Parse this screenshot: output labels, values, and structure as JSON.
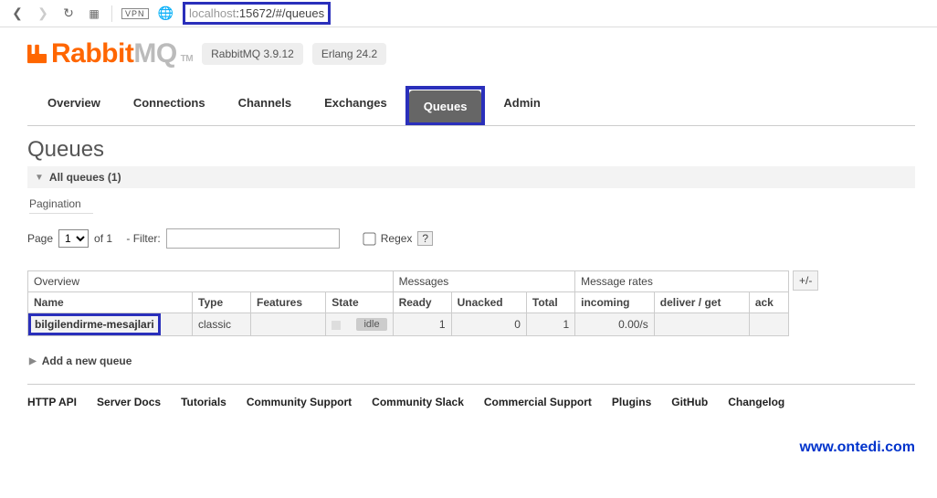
{
  "browser": {
    "url_host": "localhost",
    "url_port": ":15672",
    "url_path": "/#/queues",
    "vpn": "VPN"
  },
  "logo": {
    "r": "Rabbit",
    "mq": "MQ",
    "tm": "TM"
  },
  "versions": {
    "rmq": "RabbitMQ 3.9.12",
    "erlang": "Erlang 24.2"
  },
  "tabs": {
    "overview": "Overview",
    "connections": "Connections",
    "channels": "Channels",
    "exchanges": "Exchanges",
    "queues": "Queues",
    "admin": "Admin"
  },
  "title": "Queues",
  "section_all": "All queues (1)",
  "pagination": {
    "header": "Pagination",
    "page_lbl": "Page",
    "page_val": "1",
    "of": "of 1",
    "filter_lbl": "- Filter:",
    "regex": "Regex",
    "q": "?"
  },
  "table": {
    "grp": {
      "overview": "Overview",
      "messages": "Messages",
      "rates": "Message rates",
      "pm": "+/-"
    },
    "cols": {
      "name": "Name",
      "type": "Type",
      "features": "Features",
      "state": "State",
      "ready": "Ready",
      "unacked": "Unacked",
      "total": "Total",
      "incoming": "incoming",
      "deliver": "deliver / get",
      "ack": "ack"
    },
    "row": {
      "name": "bilgilendirme-mesajlari",
      "type": "classic",
      "state": "idle",
      "ready": "1",
      "unacked": "0",
      "total": "1",
      "incoming": "0.00/s"
    }
  },
  "addq": "Add a new queue",
  "footer": {
    "api": "HTTP API",
    "docs": "Server Docs",
    "tutorials": "Tutorials",
    "csupport": "Community Support",
    "slack": "Community Slack",
    "commercial": "Commercial Support",
    "plugins": "Plugins",
    "github": "GitHub",
    "changelog": "Changelog"
  },
  "watermark": "www.ontedi.com"
}
